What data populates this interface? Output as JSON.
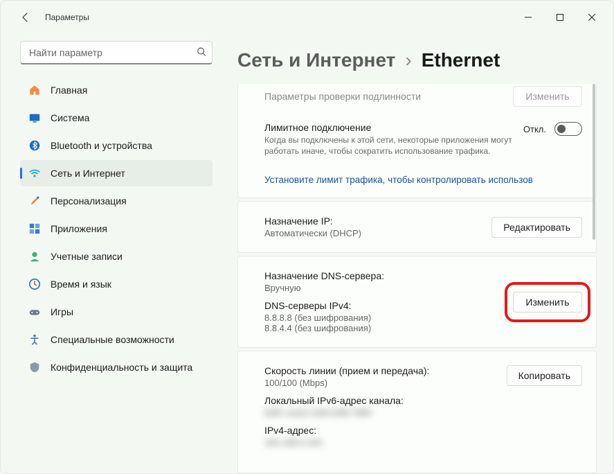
{
  "app": {
    "title": "Параметры"
  },
  "search": {
    "placeholder": "Найти параметр"
  },
  "nav": {
    "items": [
      {
        "label": "Главная"
      },
      {
        "label": "Система"
      },
      {
        "label": "Bluetooth и устройства"
      },
      {
        "label": "Сеть и Интернет"
      },
      {
        "label": "Персонализация"
      },
      {
        "label": "Приложения"
      },
      {
        "label": "Учетные записи"
      },
      {
        "label": "Время и язык"
      },
      {
        "label": "Игры"
      },
      {
        "label": "Специальные возможности"
      },
      {
        "label": "Конфиденциальность и защита"
      }
    ]
  },
  "breadcrumb": {
    "parent": "Сеть и Интернет",
    "current": "Ethernet"
  },
  "sections": {
    "auth": {
      "title": "Параметры проверки подлинности",
      "button": "Изменить"
    },
    "metered": {
      "title": "Лимитное подключение",
      "desc": "Когда вы подключены к этой сети, некоторые приложения могут работать иначе, чтобы сократить использование трафика.",
      "toggle_label": "Откл.",
      "link": "Установите лимит трафика, чтобы контролировать использов"
    },
    "ip": {
      "label": "Назначение IP:",
      "value": "Автоматически (DHCP)",
      "button": "Редактировать"
    },
    "dns": {
      "label": "Назначение DNS-сервера:",
      "value": "Вручную",
      "servers_label": "DNS-серверы IPv4:",
      "server1": "8.8.8.8 (без шифрования)",
      "server2": "8.8.4.4 (без шифрования)",
      "button": "Изменить"
    },
    "speed": {
      "label": "Скорость линии (прием и передача):",
      "value": "100/100 (Mbps)",
      "ipv6_label": "Локальный IPv6-адрес канала:",
      "ipv6_value": "fe80::a1b2:c3d4:e5f6:7890",
      "ipv4_label": "IPv4-адрес:",
      "ipv4_value": "192.168.0.100",
      "button": "Копировать"
    }
  }
}
